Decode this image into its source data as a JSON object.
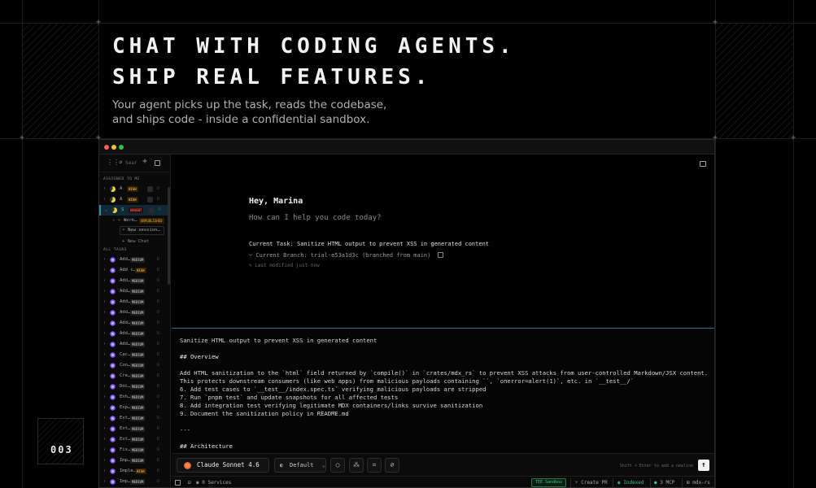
{
  "hero": {
    "title_line1": "CHAT WITH CODING AGENTS.",
    "title_line2": "SHIP REAL FEATURES.",
    "subtitle_line1": "Your agent picks up the task, reads the codebase,",
    "subtitle_line2": "and ships code - inside a confidential sandbox."
  },
  "counter": "003",
  "sidebar": {
    "search_placeholder": "Sear",
    "assigned_heading": "ASSIGNED TO ME",
    "assigned": [
      {
        "label": "A",
        "priority": "HIGH",
        "status_color": "#e8d24a"
      },
      {
        "label": "A",
        "priority": "HIGH",
        "status_color": "#e8d24a"
      },
      {
        "label": "S",
        "priority": "URGENT",
        "status_color": "#e8d24a"
      }
    ],
    "workspace_label": "Work…",
    "workspace_badge": "UNPUBLISHED",
    "new_session": "New session…",
    "new_chat": "+ New Chat",
    "all_heading": "ALL TASKS",
    "tasks": [
      {
        "label": "Add…",
        "priority": "MEDIUM"
      },
      {
        "label": "Add c…",
        "priority": "HIGH"
      },
      {
        "label": "Add…",
        "priority": "MEDIUM"
      },
      {
        "label": "Add…",
        "priority": "MEDIUM"
      },
      {
        "label": "Add…",
        "priority": "MEDIUM"
      },
      {
        "label": "Add…",
        "priority": "MEDIUM"
      },
      {
        "label": "Add…",
        "priority": "MEDIUM"
      },
      {
        "label": "Add…",
        "priority": "MEDIUM"
      },
      {
        "label": "Add…",
        "priority": "MEDIUM"
      },
      {
        "label": "Cac…",
        "priority": "MEDIUM"
      },
      {
        "label": "Con…",
        "priority": "MEDIUM"
      },
      {
        "label": "Cre…",
        "priority": "MEDIUM"
      },
      {
        "label": "Doc…",
        "priority": "MEDIUM"
      },
      {
        "label": "Enh…",
        "priority": "MEDIUM"
      },
      {
        "label": "Exp…",
        "priority": "MEDIUM"
      },
      {
        "label": "Ext…",
        "priority": "MEDIUM"
      },
      {
        "label": "Ext…",
        "priority": "MEDIUM"
      },
      {
        "label": "Ext…",
        "priority": "MEDIUM"
      },
      {
        "label": "Fix…",
        "priority": "MEDIUM"
      },
      {
        "label": "Imp…",
        "priority": "MEDIUM"
      },
      {
        "label": "Imple…",
        "priority": "HIGH"
      },
      {
        "label": "Imp…",
        "priority": "MEDIUM"
      }
    ]
  },
  "chat": {
    "greeting": "Hey, Marina",
    "prompt": "How can I help you code today?",
    "current_task": "Current Task: Sanitize HTML output to prevent XSS in generated content",
    "current_branch": "Current Branch: trial-e53a1d3c (branched from main)",
    "last_modified": "Last modified just now"
  },
  "document": {
    "title": "Sanitize HTML output to prevent XSS in generated content",
    "overview_heading": "## Overview",
    "line1": "Add HTML sanitization to the `html` field returned by `compile()` in `crates/mdx_rs` to prevent XSS attacks from user-controlled Markdown/JSX content.",
    "line2": "This protects downstream consumers (like web apps) from malicious payloads containing ``, `onerror=alert(1)`, etc. in `__test__/`",
    "step6": "6. Add test cases to `__test__/index.spec.ts` verifying malicious payloads are stripped",
    "step7": "7. Run `pnpm test` and update snapshots for all affected tests",
    "step8": "8. Add integration test verifying legitimate MDX containers/links survive sanitization",
    "step9": "9. Document the sanitization policy in README.md",
    "divider": "---",
    "arch_heading": "## Architecture"
  },
  "input_bar": {
    "model": "Claude Sonnet 4.6",
    "mode": "Default",
    "hint": "Shift + Enter to add a newline",
    "send": "↑"
  },
  "status_bar": {
    "services": "0 Services",
    "tee": "TEE Sandbox",
    "create_pr": "Create PR",
    "indexed": "Indexed",
    "mcp": "3 MCP",
    "repo": "mdx-rs"
  },
  "colors": {
    "accent": "#2e6f86",
    "status_ok": "#43c27a",
    "high": "#f0a020",
    "urgent": "#f05050",
    "task_status": "#8a5cf6"
  }
}
